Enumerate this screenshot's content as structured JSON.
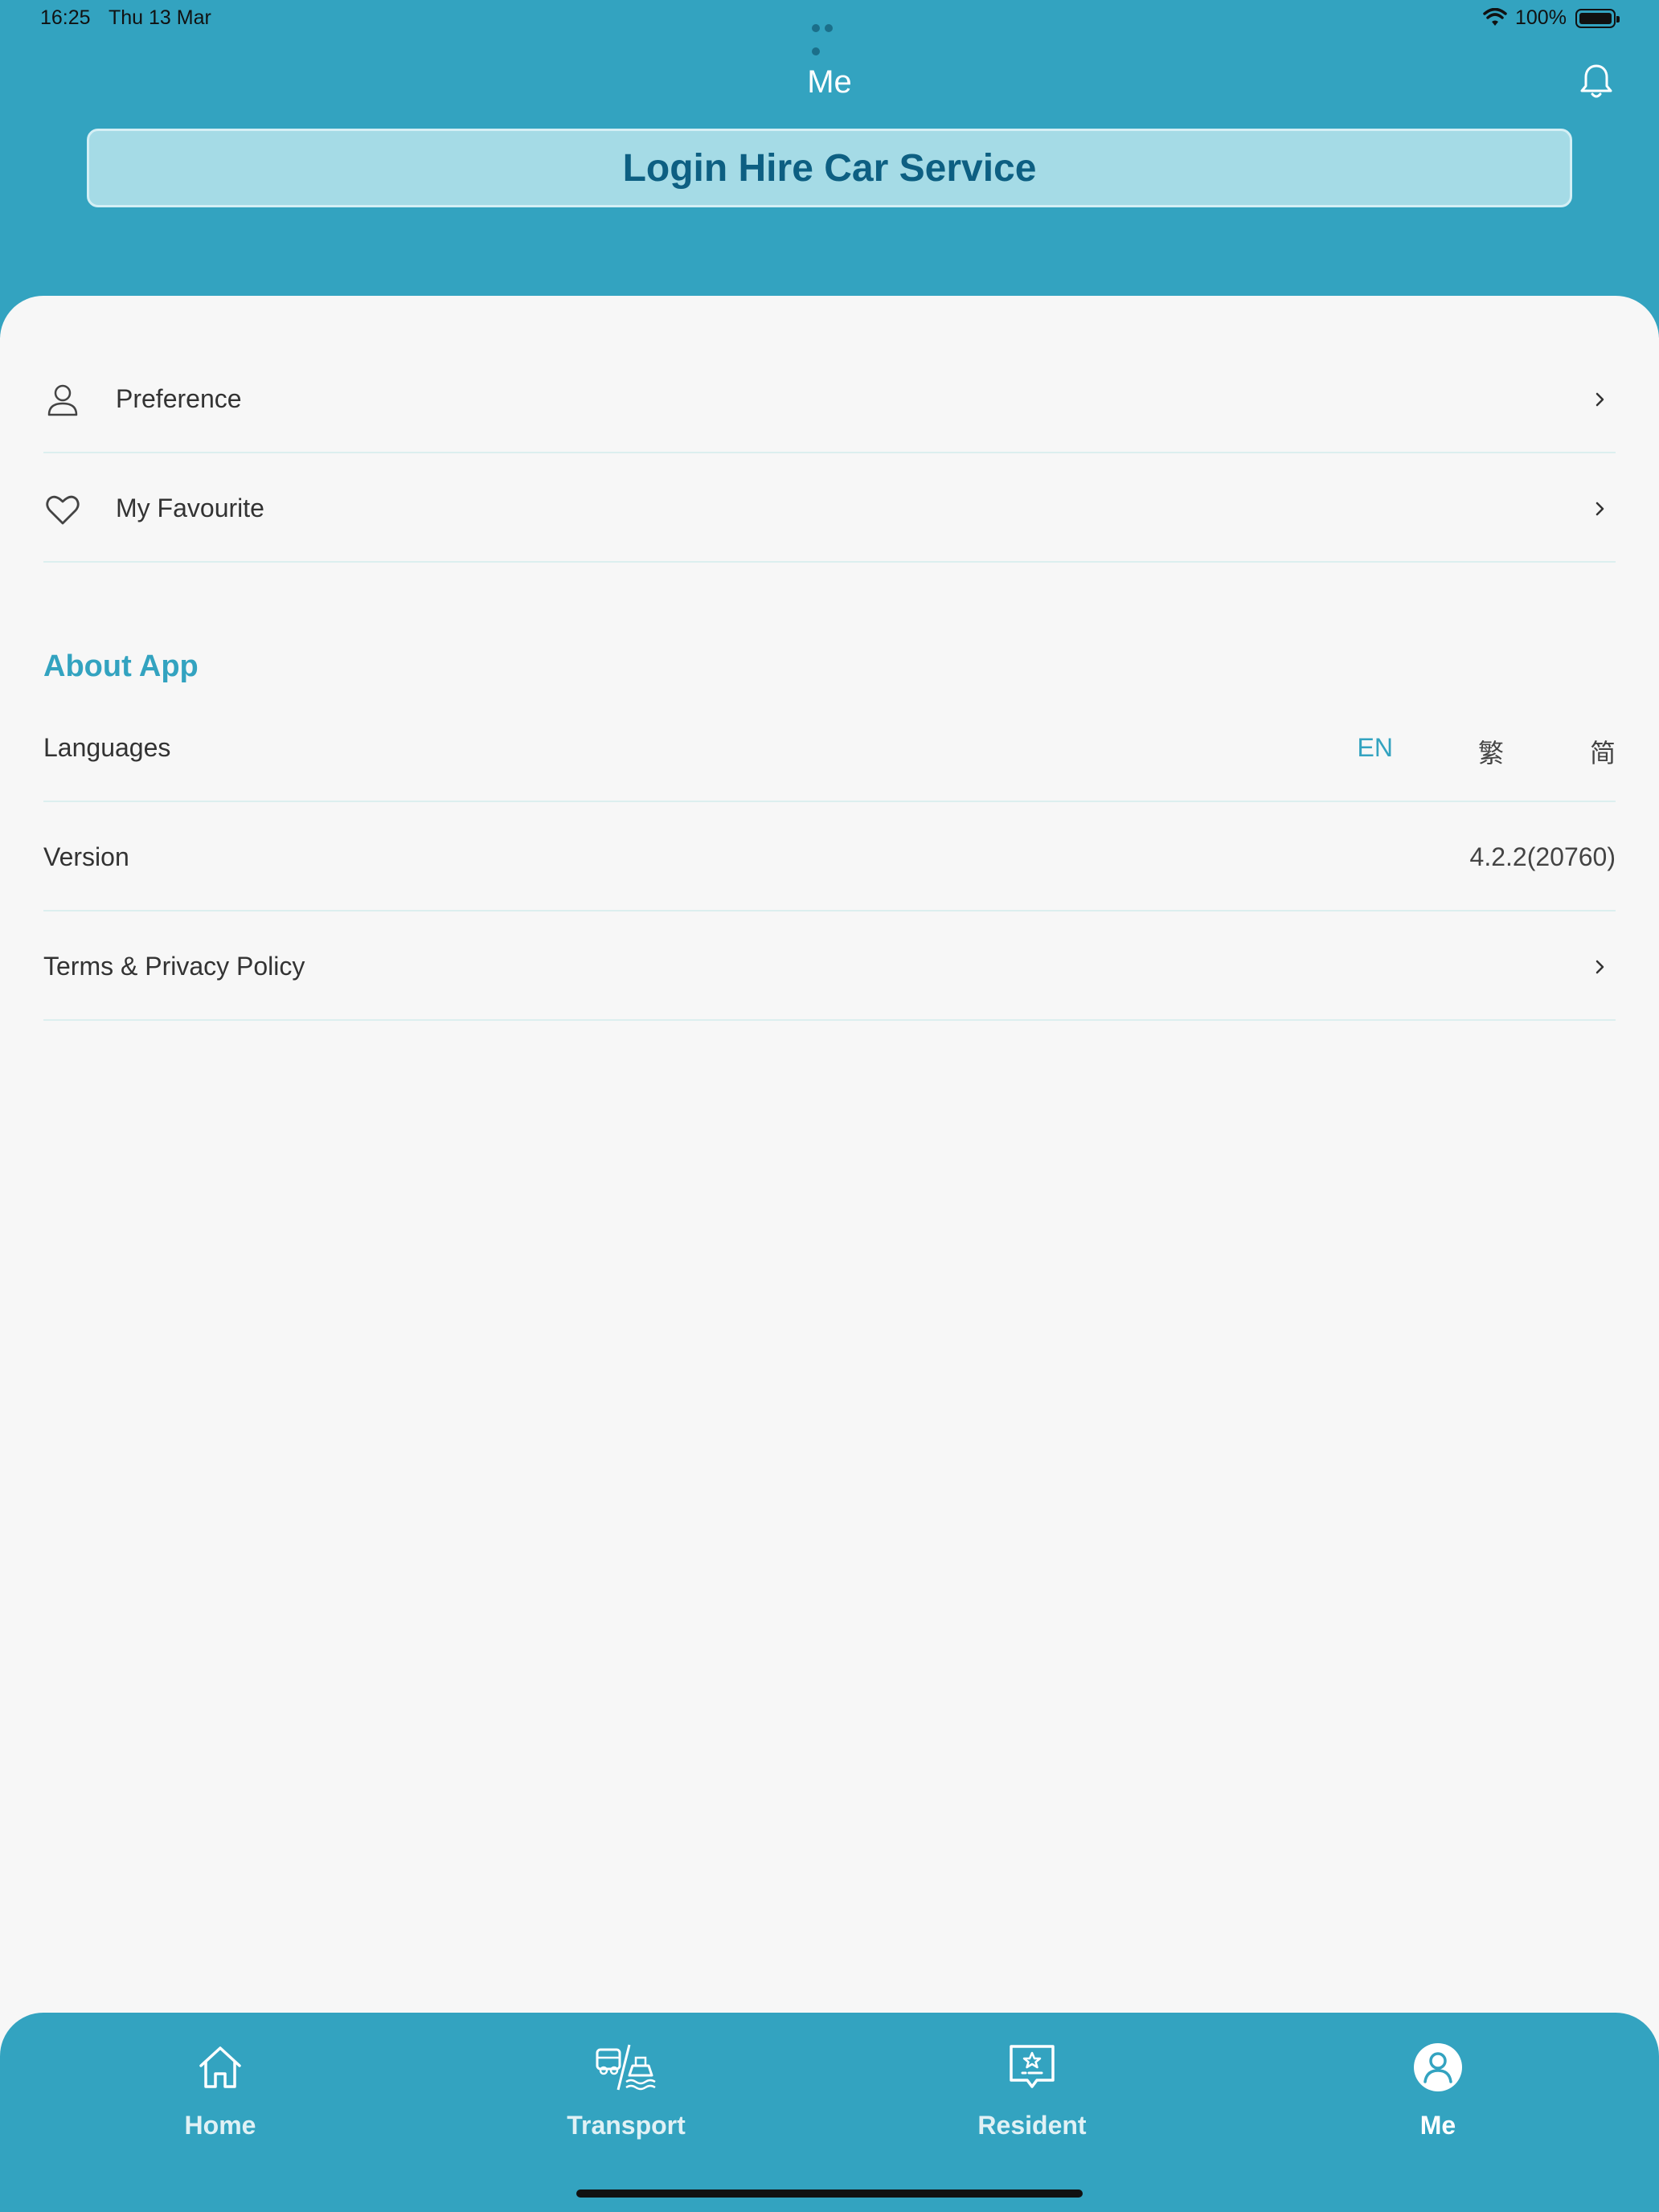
{
  "status_bar": {
    "time": "16:25",
    "date": "Thu 13 Mar",
    "battery": "100%"
  },
  "header": {
    "title": "Me",
    "login_button": "Login Hire Car Service"
  },
  "menu": {
    "preference": "Preference",
    "favourite": "My Favourite"
  },
  "about": {
    "section_title": "About App",
    "languages_label": "Languages",
    "languages": {
      "en": "EN",
      "traditional": "繁",
      "simplified": "简"
    },
    "selected_language": "EN",
    "version_label": "Version",
    "version_value": "4.2.2(20760)",
    "terms_label": "Terms & Privacy Policy"
  },
  "tabbar": {
    "home": "Home",
    "transport": "Transport",
    "resident": "Resident",
    "me": "Me",
    "active": "Me"
  },
  "colors": {
    "primary": "#33a3c0",
    "login_button_bg": "#a5dbe6",
    "login_button_text": "#0d5f82",
    "page_bg": "#f7f7f7"
  }
}
